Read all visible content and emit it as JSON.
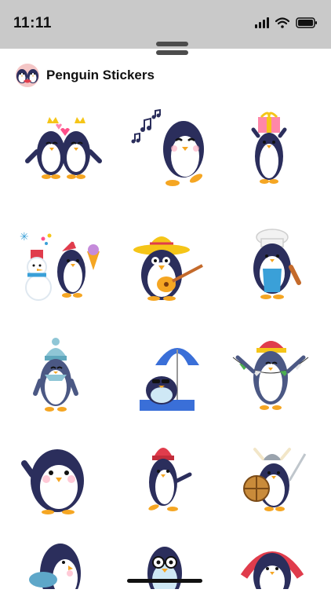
{
  "status_bar": {
    "time": "11:11",
    "icons": [
      "cellular-signal-icon",
      "wifi-icon",
      "battery-icon"
    ]
  },
  "app": {
    "title": "Penguin Stickers",
    "icon": "penguin-couple-icon"
  },
  "stickers": [
    {
      "name": "penguin-couple-crowns-sticker"
    },
    {
      "name": "penguin-music-notes-sticker"
    },
    {
      "name": "penguin-gift-box-sticker"
    },
    {
      "name": "penguin-snowman-sticker"
    },
    {
      "name": "penguin-sombrero-guitar-sticker"
    },
    {
      "name": "penguin-chef-sticker"
    },
    {
      "name": "penguin-winter-hat-sticker"
    },
    {
      "name": "penguin-beach-umbrella-sticker"
    },
    {
      "name": "penguin-santa-hat-garland-sticker"
    },
    {
      "name": "penguin-waving-sticker"
    },
    {
      "name": "penguin-red-beanie-sticker"
    },
    {
      "name": "penguin-viking-sticker"
    },
    {
      "name": "penguin-fish-sticker"
    },
    {
      "name": "penguin-glasses-sticker"
    },
    {
      "name": "penguin-headphones-sticker"
    }
  ],
  "colors": {
    "status_bar_bg": "#c9c9c9",
    "penguin_body": "#2b2e5c",
    "belly": "#ffffff",
    "beak": "#f5a623"
  }
}
